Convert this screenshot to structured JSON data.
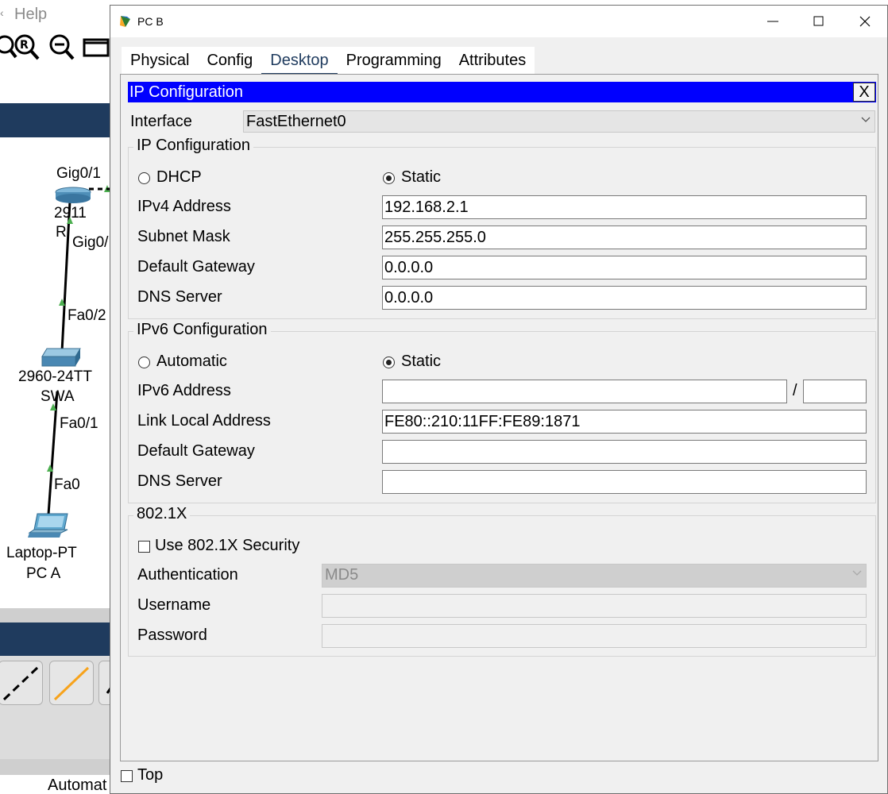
{
  "background": {
    "menu_help": "Help",
    "topology": {
      "router_port_top": "Gig0/1",
      "router_model": "2911",
      "router_name_partial": "R",
      "router_port_bottom": "Gig0/",
      "switch_port_up": "Fa0/2",
      "switch_model": "2960-24TT",
      "switch_name": "SWA",
      "switch_port_down": "Fa0/1",
      "laptop_port": "Fa0",
      "laptop_model": "Laptop-PT",
      "laptop_name": "PC A"
    },
    "status_partial": "Automat"
  },
  "window": {
    "title": "PC B",
    "tabs": [
      "Physical",
      "Config",
      "Desktop",
      "Programming",
      "Attributes"
    ],
    "active_tab": "Desktop",
    "top_checkbox_label": "Top"
  },
  "ip_config": {
    "header": "IP Configuration",
    "close_label": "X",
    "interface_label": "Interface",
    "interface_value": "FastEthernet0",
    "ipv4": {
      "group_title": "IP Configuration",
      "dhcp_label": "DHCP",
      "static_label": "Static",
      "address_label": "IPv4 Address",
      "address_value": "192.168.2.1",
      "mask_label": "Subnet Mask",
      "mask_value": "255.255.255.0",
      "gateway_label": "Default Gateway",
      "gateway_value": "0.0.0.0",
      "dns_label": "DNS Server",
      "dns_value": "0.0.0.0"
    },
    "ipv6": {
      "group_title": "IPv6 Configuration",
      "auto_label": "Automatic",
      "static_label": "Static",
      "address_label": "IPv6 Address",
      "address_value": "",
      "prefix_sep": "/",
      "prefix_value": "",
      "link_local_label": "Link Local Address",
      "link_local_value": "FE80::210:11FF:FE89:1871",
      "gateway_label": "Default Gateway",
      "gateway_value": "",
      "dns_label": "DNS Server",
      "dns_value": ""
    },
    "dot1x": {
      "group_title": "802.1X",
      "use_label": "Use 802.1X Security",
      "auth_label": "Authentication",
      "auth_value": "MD5",
      "username_label": "Username",
      "username_value": "",
      "password_label": "Password",
      "password_value": ""
    }
  }
}
